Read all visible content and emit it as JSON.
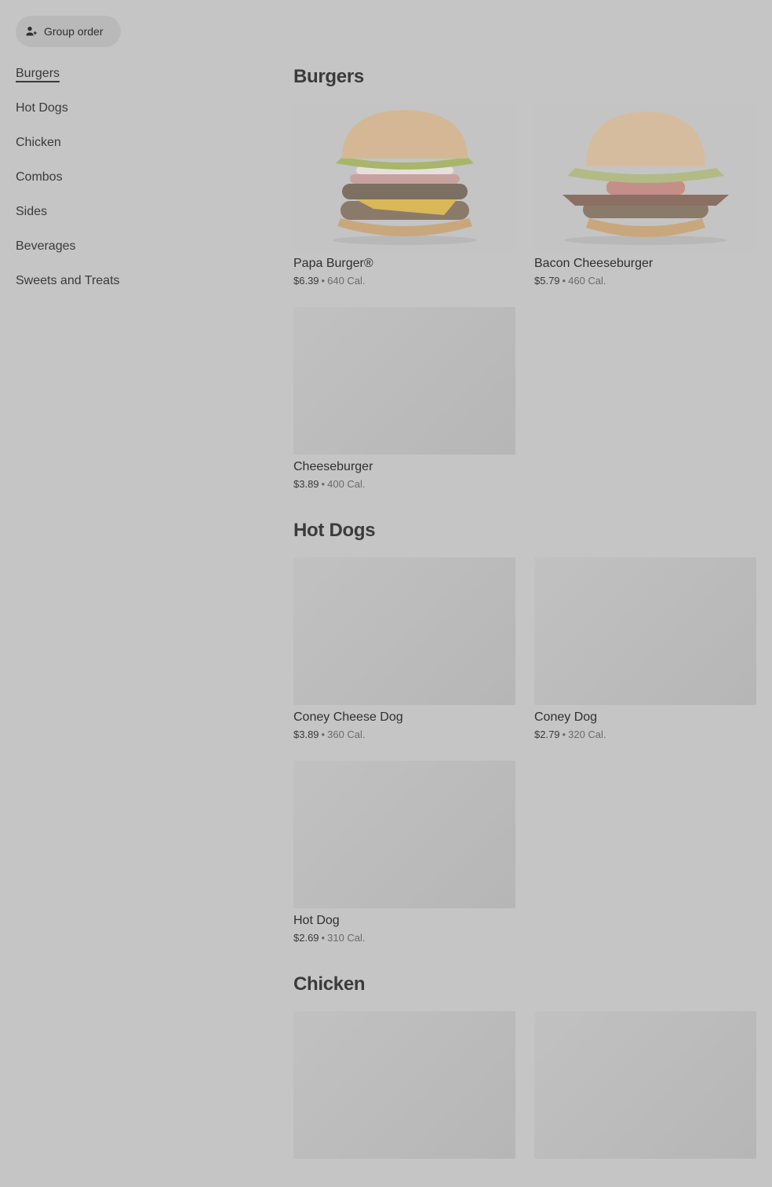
{
  "header": {
    "group_order_label": "Group order"
  },
  "sidebar": {
    "items": [
      {
        "label": "Burgers",
        "active": true
      },
      {
        "label": "Hot Dogs"
      },
      {
        "label": "Chicken"
      },
      {
        "label": "Combos"
      },
      {
        "label": "Sides"
      },
      {
        "label": "Beverages"
      },
      {
        "label": "Sweets and Treats"
      }
    ]
  },
  "sections": [
    {
      "title": "Burgers",
      "items": [
        {
          "name": "Papa Burger®",
          "price": "$6.39",
          "calories": "640 Cal."
        },
        {
          "name": "Bacon Cheeseburger",
          "price": "$5.79",
          "calories": "460 Cal."
        },
        {
          "name": "Cheeseburger",
          "price": "$3.89",
          "calories": "400 Cal."
        }
      ]
    },
    {
      "title": "Hot Dogs",
      "items": [
        {
          "name": "Coney Cheese Dog",
          "price": "$3.89",
          "calories": "360 Cal."
        },
        {
          "name": "Coney Dog",
          "price": "$2.79",
          "calories": "320 Cal."
        },
        {
          "name": "Hot Dog",
          "price": "$2.69",
          "calories": "310 Cal."
        }
      ]
    },
    {
      "title": "Chicken",
      "items": []
    }
  ],
  "separator": "•",
  "colors": {
    "overlay_bg": "#c5c5c5",
    "text": "#3a3a3a"
  }
}
